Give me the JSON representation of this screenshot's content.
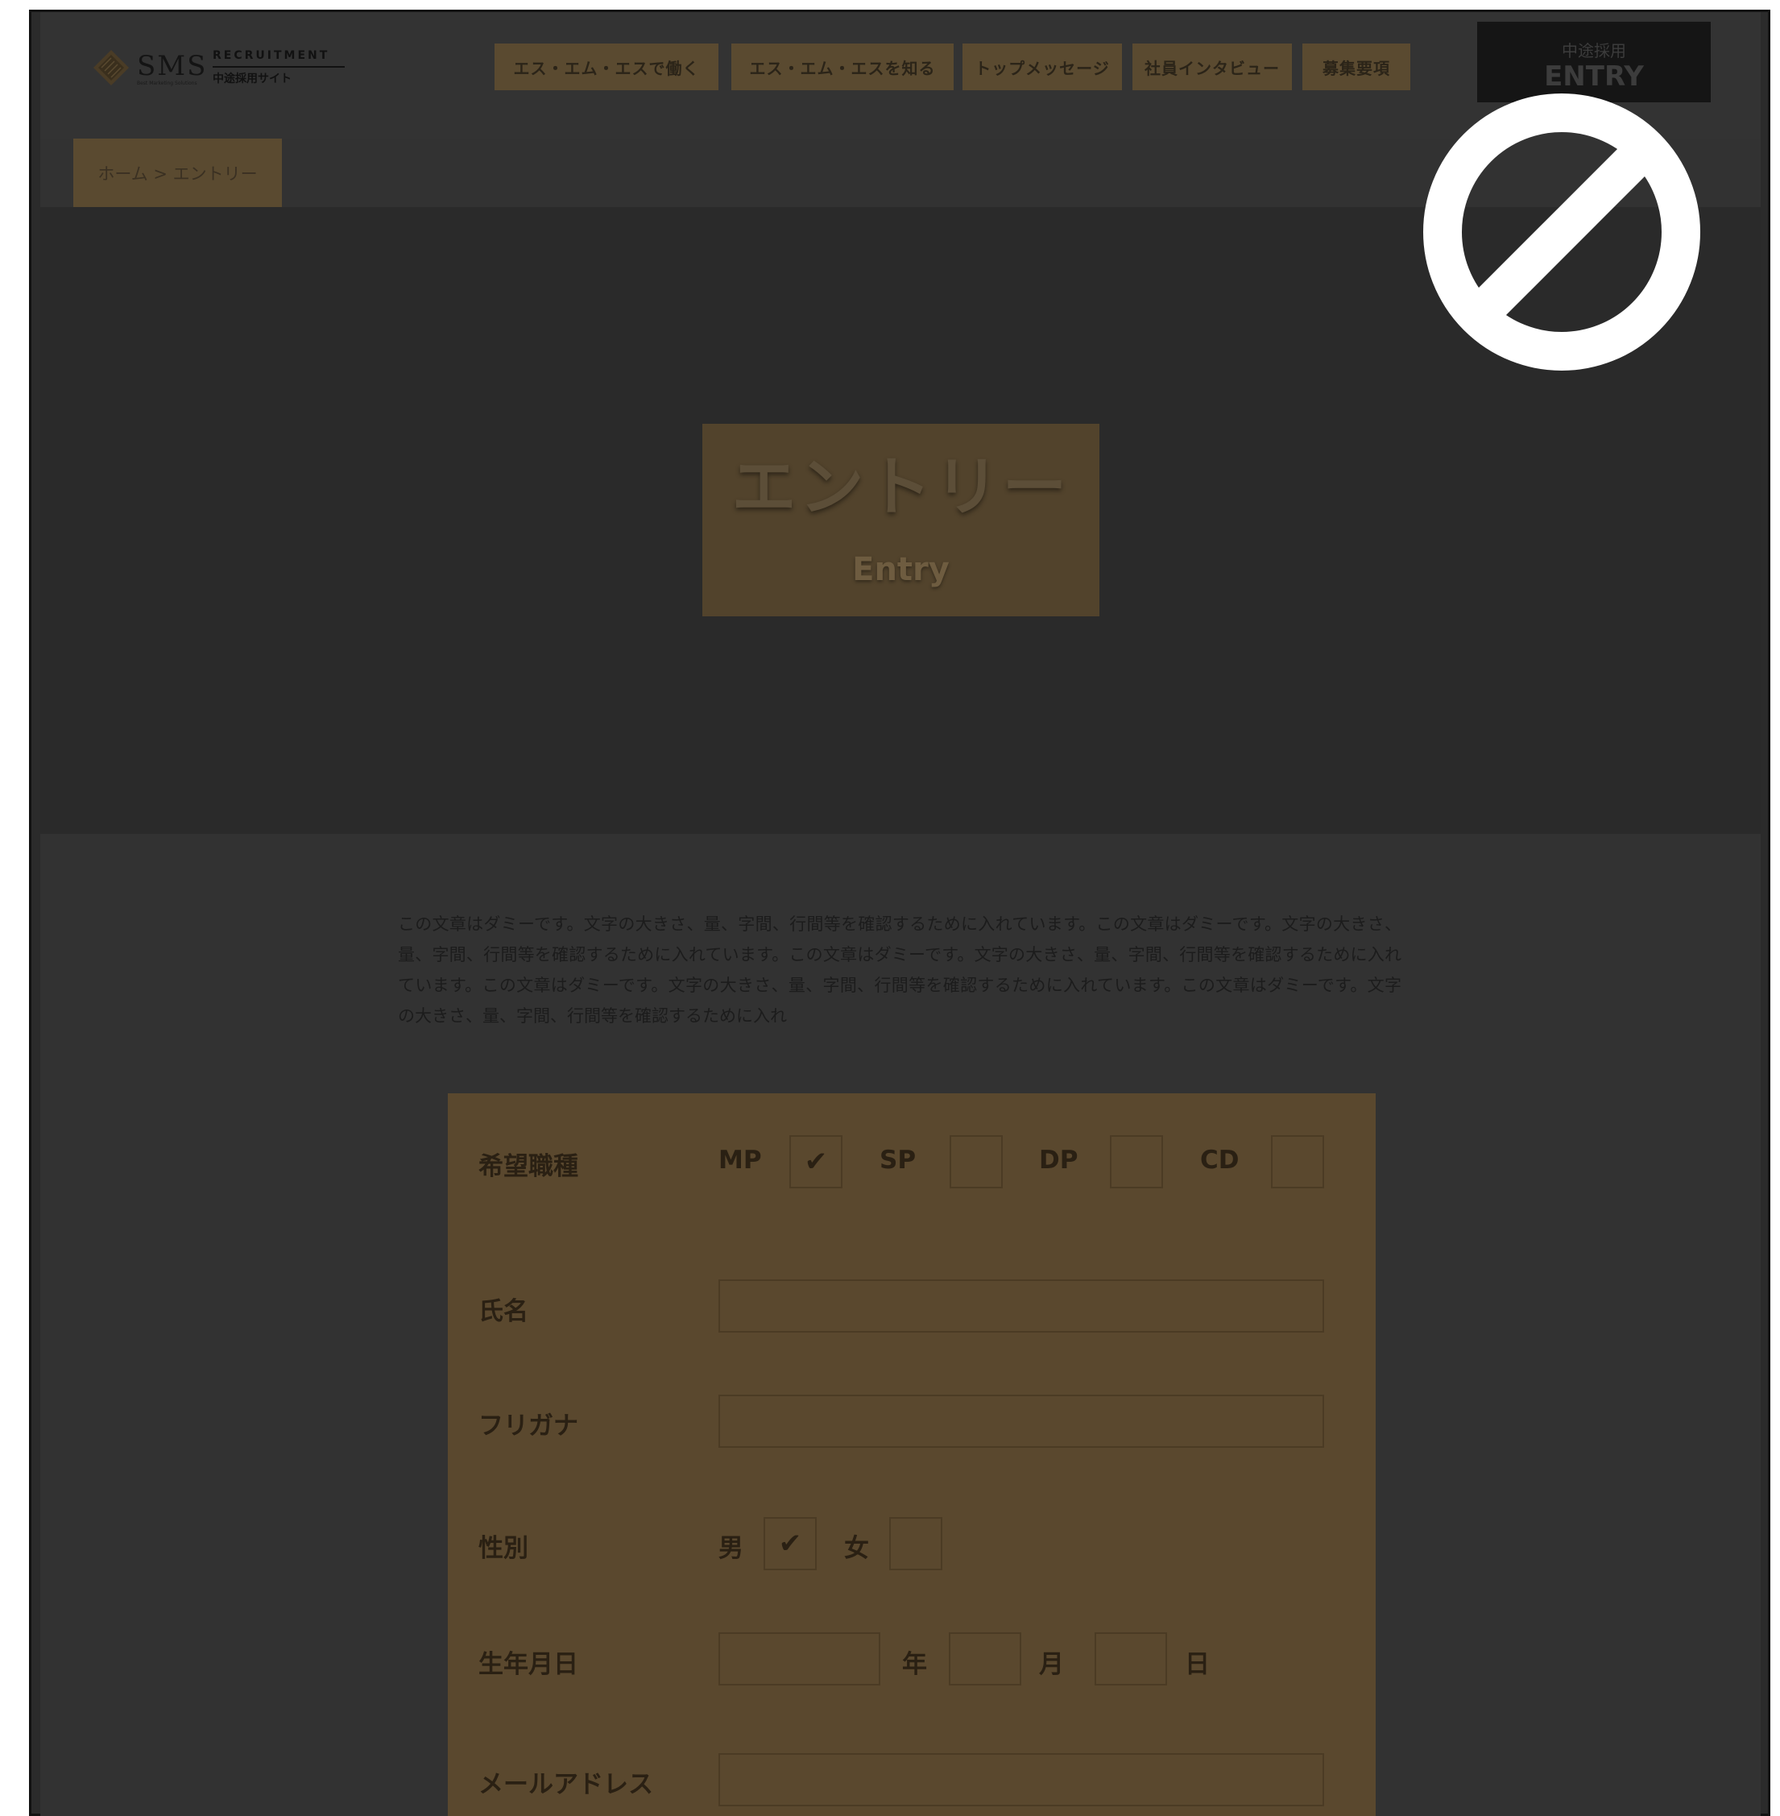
{
  "brand": {
    "name": "SMS",
    "tagline": "RECRUITMENT",
    "subtitle": "中途採用サイト",
    "small_text": "Best Marketing Solutions"
  },
  "nav": [
    {
      "label": "エス・エム・エスで働く"
    },
    {
      "label": "エス・エム・エスを知る"
    },
    {
      "label": "トップメッセージ"
    },
    {
      "label": "社員インタビュー"
    },
    {
      "label": "募集要項"
    }
  ],
  "entry_button": {
    "small": "中途採用",
    "big": "ENTRY"
  },
  "breadcrumb": "ホーム > エントリー",
  "hero": {
    "title": "エントリー",
    "subtitle": "Entry"
  },
  "overlay": {
    "icon": "prohibited-icon"
  },
  "intro": "この文章はダミーです。文字の大きさ、量、字間、行間等を確認するために入れています。この文章はダミーです。文字の大きさ、量、字間、行間等を確認するために入れています。この文章はダミーです。文字の大きさ、量、字間、行間等を確認するために入れています。この文章はダミーです。文字の大きさ、量、字間、行間等を確認するために入れています。この文章はダミーです。文字の大きさ、量、字間、行間等を確認するために入れ",
  "form": {
    "job": {
      "label": "希望職種",
      "options": [
        {
          "label": "MP",
          "checked": true
        },
        {
          "label": "SP",
          "checked": false
        },
        {
          "label": "DP",
          "checked": false
        },
        {
          "label": "CD",
          "checked": false
        }
      ]
    },
    "name": {
      "label": "氏名",
      "value": ""
    },
    "furigana": {
      "label": "フリガナ",
      "value": ""
    },
    "gender": {
      "label": "性別",
      "options": [
        {
          "label": "男",
          "checked": true
        },
        {
          "label": "女",
          "checked": false
        }
      ]
    },
    "birthdate": {
      "label": "生年月日",
      "year_unit": "年",
      "month_unit": "月",
      "day_unit": "日"
    },
    "email": {
      "label": "メールアドレス",
      "value": ""
    },
    "check_mark": "✔"
  },
  "colors": {
    "overlay_dark": "#2b2b2b",
    "accent_dim": "#5a482e",
    "prohibited_icon": "#ffffff"
  }
}
